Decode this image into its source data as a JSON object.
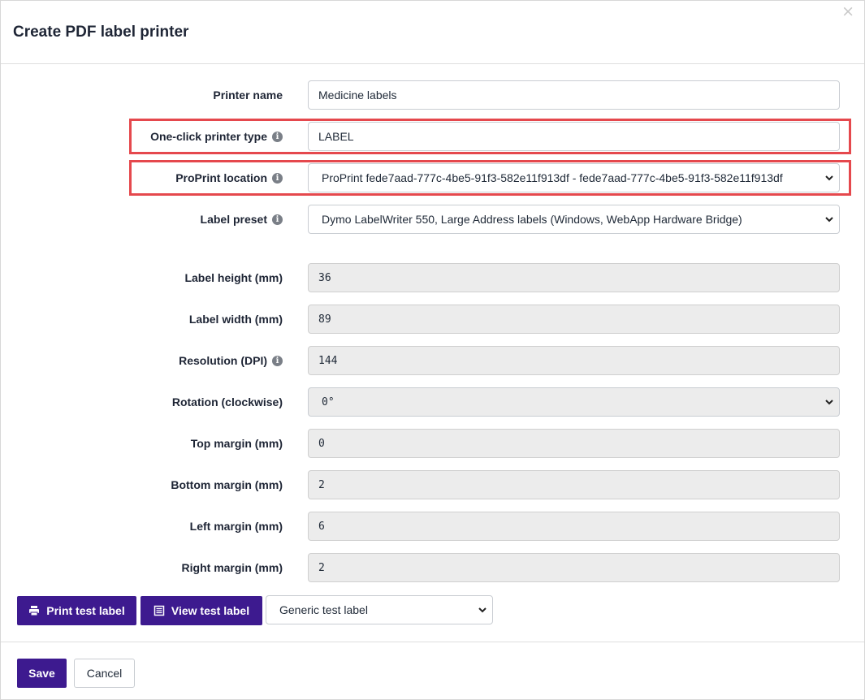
{
  "dialog": {
    "title": "Create PDF label printer",
    "close_glyph": "×"
  },
  "fields": {
    "printer_name": {
      "label": "Printer name",
      "value": "Medicine labels"
    },
    "one_click_type": {
      "label": "One-click printer type",
      "value": "LABEL"
    },
    "proprint_location": {
      "label": "ProPrint location",
      "value": "ProPrint fede7aad-777c-4be5-91f3-582e11f913df - fede7aad-777c-4be5-91f3-582e11f913df"
    },
    "label_preset": {
      "label": "Label preset",
      "value": "Dymo LabelWriter 550, Large Address labels (Windows, WebApp Hardware Bridge)"
    },
    "label_height": {
      "label": "Label height (mm)",
      "value": "36"
    },
    "label_width": {
      "label": "Label width (mm)",
      "value": "89"
    },
    "resolution": {
      "label": "Resolution (DPI)",
      "value": "144"
    },
    "rotation": {
      "label": "Rotation (clockwise)",
      "value": "0°"
    },
    "top_margin": {
      "label": "Top margin (mm)",
      "value": "0"
    },
    "bottom_margin": {
      "label": "Bottom margin (mm)",
      "value": "2"
    },
    "left_margin": {
      "label": "Left margin (mm)",
      "value": "6"
    },
    "right_margin": {
      "label": "Right margin (mm)",
      "value": "2"
    }
  },
  "info_glyph": "i",
  "actions": {
    "print_test_label": "Print test label",
    "view_test_label": "View test label",
    "test_label_type": "Generic test label"
  },
  "footer": {
    "save": "Save",
    "cancel": "Cancel"
  },
  "icons": [
    "close-icon",
    "info-icon",
    "chevron-down-icon",
    "printer-icon",
    "document-list-icon"
  ],
  "colors": {
    "primary": "#3d1a8f",
    "highlight": "#e5484d",
    "readonly_bg": "#ececec"
  }
}
